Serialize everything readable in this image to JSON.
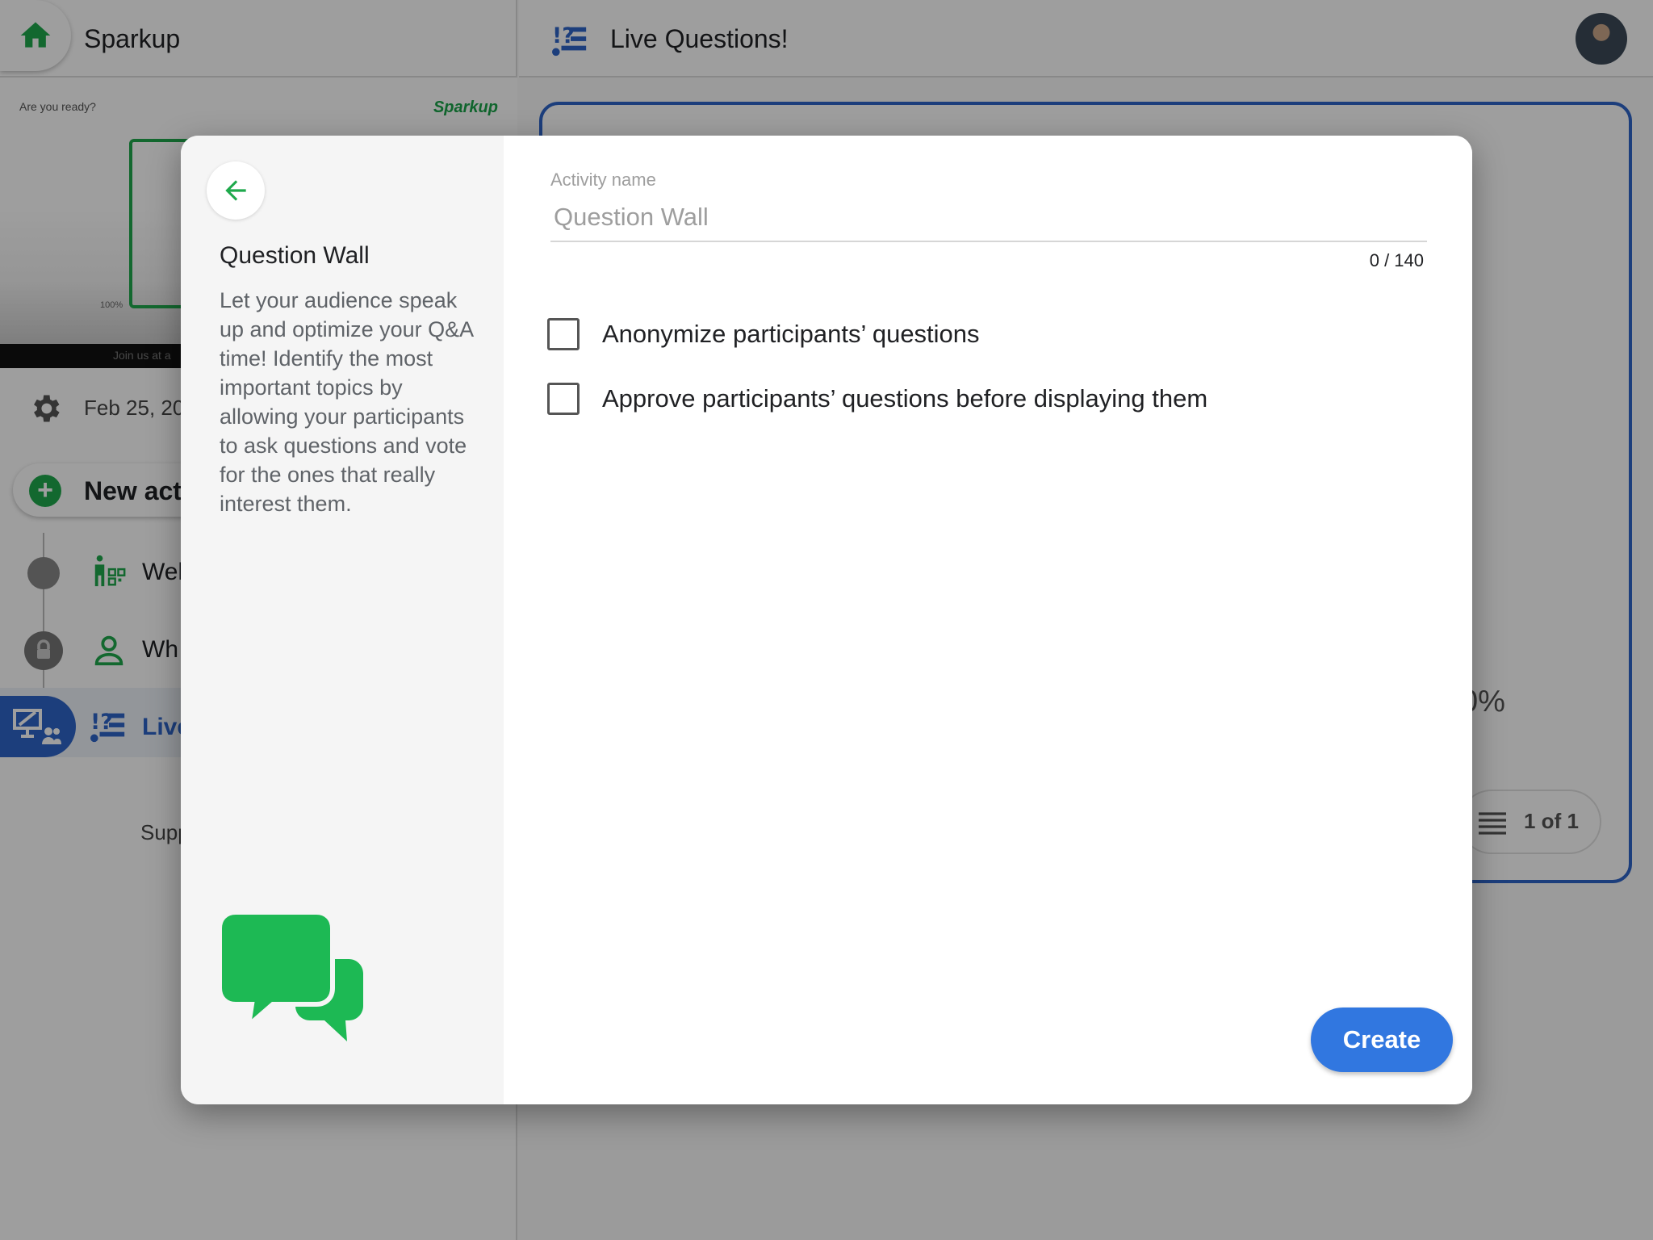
{
  "app": {
    "name": "Sparkup",
    "page_title": "Live Questions!"
  },
  "sidebar": {
    "preview": {
      "prompt": "Are you ready?",
      "logo": "Sparkup",
      "percent": "100%",
      "join_text": "Join us at a"
    },
    "session_date": "Feb 25, 20",
    "new_activity_label": "New act",
    "activities": [
      {
        "label": "Wel",
        "icon": "qr-person-icon",
        "status": "done"
      },
      {
        "label": "Wh",
        "icon": "person-icon",
        "status": "locked"
      },
      {
        "label": "Live",
        "icon": "question-wall-icon",
        "status": "active"
      }
    ],
    "support_label": "Supp"
  },
  "main": {
    "card_percent": "0%",
    "pager": "1 of 1"
  },
  "dialog": {
    "title": "Question Wall",
    "description": "Let your audience speak up and optimize your Q&A time! Identify the most important topics by allowing your participants to ask questions and vote for the ones that really interest them.",
    "activity_name_label": "Activity name",
    "activity_name_placeholder": "Question Wall",
    "activity_name_value": "",
    "counter": "0 / 140",
    "options": [
      {
        "label": "Anonymize participants’ questions",
        "checked": false
      },
      {
        "label": "Approve participants’ questions before displaying them",
        "checked": false
      }
    ],
    "create_label": "Create"
  },
  "colors": {
    "brand_green": "#1fa94c",
    "accent_blue": "#3177e0",
    "active_nav_blue": "#2e64c8"
  }
}
